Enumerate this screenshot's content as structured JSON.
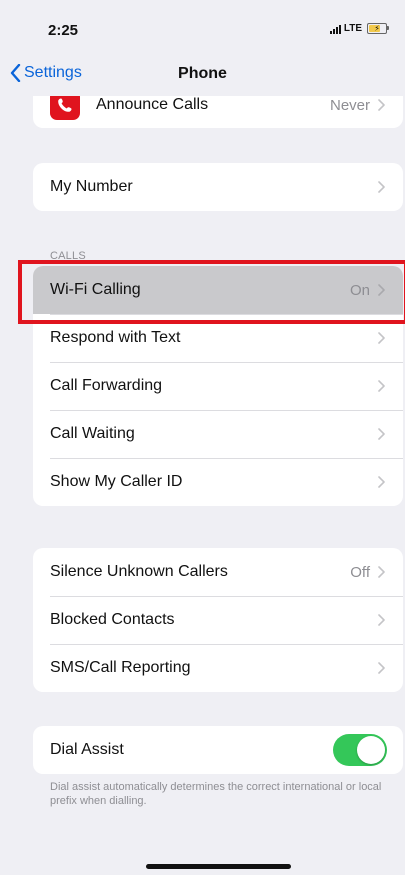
{
  "status_bar": {
    "time": "2:25",
    "network": "LTE"
  },
  "nav": {
    "back_label": "Settings",
    "title": "Phone"
  },
  "top_group": {
    "announce_calls": {
      "label": "Announce Calls",
      "value": "Never"
    }
  },
  "my_number_group": {
    "label": "My Number"
  },
  "calls_section": {
    "header": "CALLS",
    "items": [
      {
        "label": "Wi-Fi Calling",
        "value": "On"
      },
      {
        "label": "Respond with Text",
        "value": ""
      },
      {
        "label": "Call Forwarding",
        "value": ""
      },
      {
        "label": "Call Waiting",
        "value": ""
      },
      {
        "label": "Show My Caller ID",
        "value": ""
      }
    ]
  },
  "blocking_group": {
    "items": [
      {
        "label": "Silence Unknown Callers",
        "value": "Off"
      },
      {
        "label": "Blocked Contacts",
        "value": ""
      },
      {
        "label": "SMS/Call Reporting",
        "value": ""
      }
    ]
  },
  "dial_assist": {
    "label": "Dial Assist",
    "enabled": true,
    "footer": "Dial assist automatically determines the correct international or local prefix when dialling."
  },
  "colors": {
    "accent": "#0a64d9",
    "toggle_on": "#34c759",
    "highlight": "#e0141e",
    "background": "#efeff4"
  }
}
